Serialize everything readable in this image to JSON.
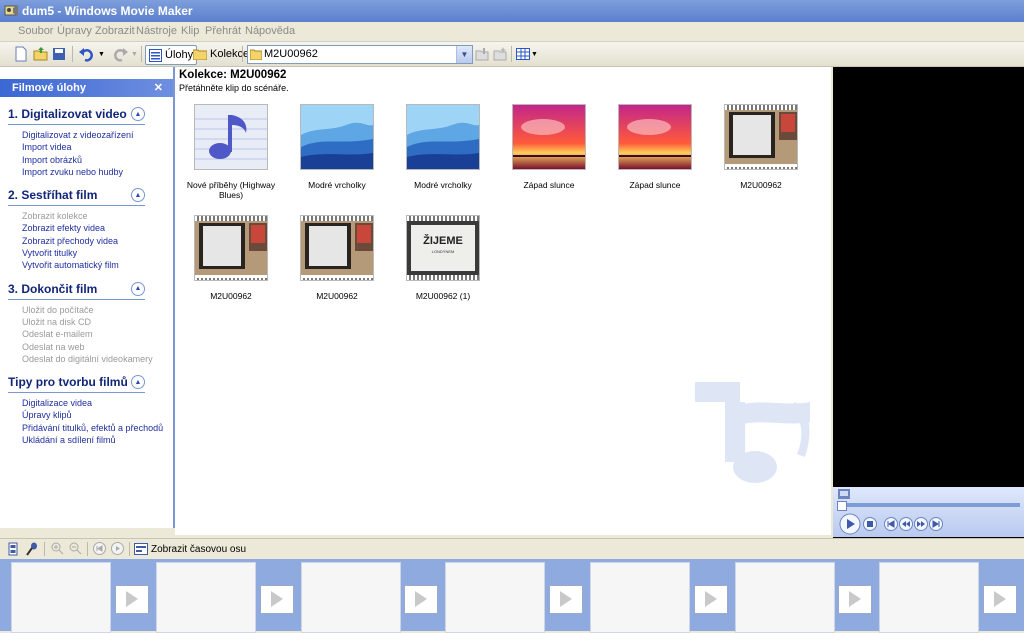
{
  "window": {
    "title": "dum5 - Windows Movie Maker"
  },
  "menu": [
    "Soubor",
    "Úpravy",
    "Zobrazit",
    "Nástroje",
    "Klip",
    "Přehrát",
    "Nápověda"
  ],
  "toolbar": {
    "tasks_label": "Úlohy",
    "collections_label": "Kolekce",
    "collection_value": "M2U00962"
  },
  "tasks_panel": {
    "header": "Filmové úlohy",
    "sections": [
      {
        "title": "1. Digitalizovat video",
        "links": [
          {
            "label": "Digitalizovat z videozařízení",
            "enabled": true
          },
          {
            "label": "Import videa",
            "enabled": true
          },
          {
            "label": "Import obrázků",
            "enabled": true
          },
          {
            "label": "Import zvuku nebo hudby",
            "enabled": true
          }
        ]
      },
      {
        "title": "2. Sestříhat film",
        "links": [
          {
            "label": "Zobrazit kolekce",
            "enabled": false
          },
          {
            "label": "Zobrazit efekty videa",
            "enabled": true
          },
          {
            "label": "Zobrazit přechody videa",
            "enabled": true
          },
          {
            "label": "Vytvořit titulky",
            "enabled": true
          },
          {
            "label": "Vytvořit automatický film",
            "enabled": true
          }
        ]
      },
      {
        "title": "3. Dokončit film",
        "links": [
          {
            "label": "Uložit do počítače",
            "enabled": false
          },
          {
            "label": "Uložit na disk CD",
            "enabled": false
          },
          {
            "label": "Odeslat e-mailem",
            "enabled": false
          },
          {
            "label": "Odeslat na web",
            "enabled": false
          },
          {
            "label": "Odeslat do digitální videokamery",
            "enabled": false
          }
        ]
      },
      {
        "title": "Tipy pro tvorbu filmů",
        "links": [
          {
            "label": "Digitalizace videa",
            "enabled": true
          },
          {
            "label": "Úpravy klipů",
            "enabled": true
          },
          {
            "label": "Přidávání titulků, efektů a přechodů",
            "enabled": true
          },
          {
            "label": "Ukládání a sdílení filmů",
            "enabled": true
          }
        ]
      }
    ]
  },
  "collection": {
    "title": "Kolekce: M2U00962",
    "hint": "Přetáhněte klip do scénáře.",
    "items": [
      {
        "label": "Nové příběhy (Highway Blues)",
        "kind": "music"
      },
      {
        "label": "Modré vrcholky",
        "kind": "mountains"
      },
      {
        "label": "Modré vrcholky",
        "kind": "mountains"
      },
      {
        "label": "Západ slunce",
        "kind": "sunset"
      },
      {
        "label": "Západ slunce",
        "kind": "sunset"
      },
      {
        "label": "M2U00962",
        "kind": "video"
      },
      {
        "label": "M2U00962",
        "kind": "video"
      },
      {
        "label": "M2U00962",
        "kind": "video"
      },
      {
        "label": "M2U00962 (1)",
        "kind": "video-text",
        "overlay": "ŽIJEME",
        "overlay_sub": "LONDÝNEM"
      }
    ]
  },
  "timeline": {
    "show_timeline_label": "Zobrazit časovou osu"
  }
}
